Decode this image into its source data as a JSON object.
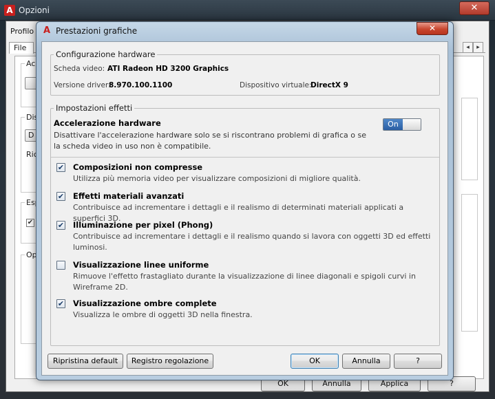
{
  "background_window": {
    "title": "Opzioni",
    "close_glyph": "✕",
    "profile_label": "Profilo c",
    "file_tab_label": "File",
    "tab_scroll_left": "◂",
    "tab_scroll_right": "▸",
    "fragments": [
      "Acc",
      "Dis",
      "D",
      "Ric",
      "Esp",
      "Op"
    ],
    "bottom_buttons": [
      "OK",
      "Annulla",
      "Applica",
      "?"
    ]
  },
  "dialog": {
    "title": "Prestazioni grafiche",
    "app_icon_glyph": "A",
    "close_glyph": "✕",
    "hardware": {
      "group_title": "Configurazione hardware",
      "video_card_label": "Scheda video:",
      "video_card_value": "ATI Radeon HD 3200 Graphics",
      "driver_label": "Versione driver:",
      "driver_value": "8.970.100.1100",
      "virtual_device_label": "Dispositivo virtuale:",
      "virtual_device_value": "DirectX 9"
    },
    "effects": {
      "group_title": "Impostazioni effetti",
      "hw_accel": {
        "title": "Accelerazione hardware",
        "description": "Disattivare l'accelerazione hardware solo se si riscontrano problemi di grafica o se la scheda video in uso non è compatibile.",
        "toggle_label": "On",
        "state": "on"
      },
      "options": [
        {
          "title": "Composizioni non compresse",
          "description": "Utilizza più memoria video per visualizzare composizioni di migliore qualità.",
          "checked": true
        },
        {
          "title": "Effetti materiali avanzati",
          "description": "Contribuisce ad incrementare i dettagli e il realismo di determinati materiali applicati a superfici 3D.",
          "checked": true
        },
        {
          "title": "Illuminazione per pixel (Phong)",
          "description": "Contribuisce ad incrementare i dettagli e il realismo quando si lavora con oggetti 3D ed effetti luminosi.",
          "checked": true
        },
        {
          "title": "Visualizzazione linee uniforme",
          "description": "Rimuove l'effetto frastagliato durante la visualizzazione di linee diagonali e spigoli curvi in Wireframe 2D.",
          "checked": false
        },
        {
          "title": "Visualizzazione ombre complete",
          "description": "Visualizza le ombre di oggetti 3D nella finestra.",
          "checked": true
        }
      ]
    },
    "buttons": {
      "reset": "Ripristina default",
      "tuning_log": "Registro regolazione",
      "ok": "OK",
      "cancel": "Annulla",
      "help": "?"
    },
    "check_glyph": "✔"
  }
}
